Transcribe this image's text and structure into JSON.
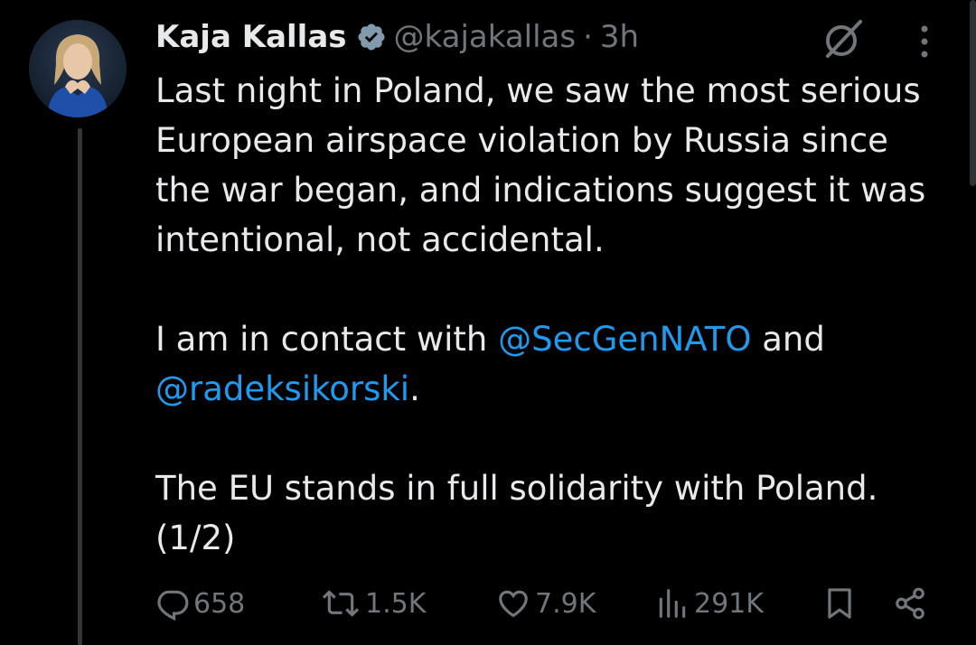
{
  "author": {
    "name": "Kaja Kallas",
    "handle": "@kajakallas",
    "separator": "·",
    "time": "3h"
  },
  "tweet": {
    "para1": "Last night in Poland, we saw the most serious European airspace violation by Russia since the war began, and indications suggest it was intentional, not accidental.",
    "para2_prefix": "I am in contact with ",
    "mention1": "@SecGenNATO",
    "para2_middle": " and ",
    "mention2": "@radeksikorski",
    "para2_suffix": ".",
    "para3": "The EU stands in full solidarity with Poland. (1/2)"
  },
  "actions": {
    "replies": "658",
    "reposts": "1.5K",
    "likes": "7.9K",
    "views": "291K"
  },
  "colors": {
    "background": "#000000",
    "text": "#e7e9ea",
    "muted": "#71767b",
    "link": "#1d9bf0",
    "verified_badge": "#829aab"
  },
  "icons": [
    "verified-badge-icon",
    "grok-icon",
    "more-icon",
    "reply-icon",
    "repost-icon",
    "like-icon",
    "views-icon",
    "bookmark-icon",
    "share-icon"
  ]
}
